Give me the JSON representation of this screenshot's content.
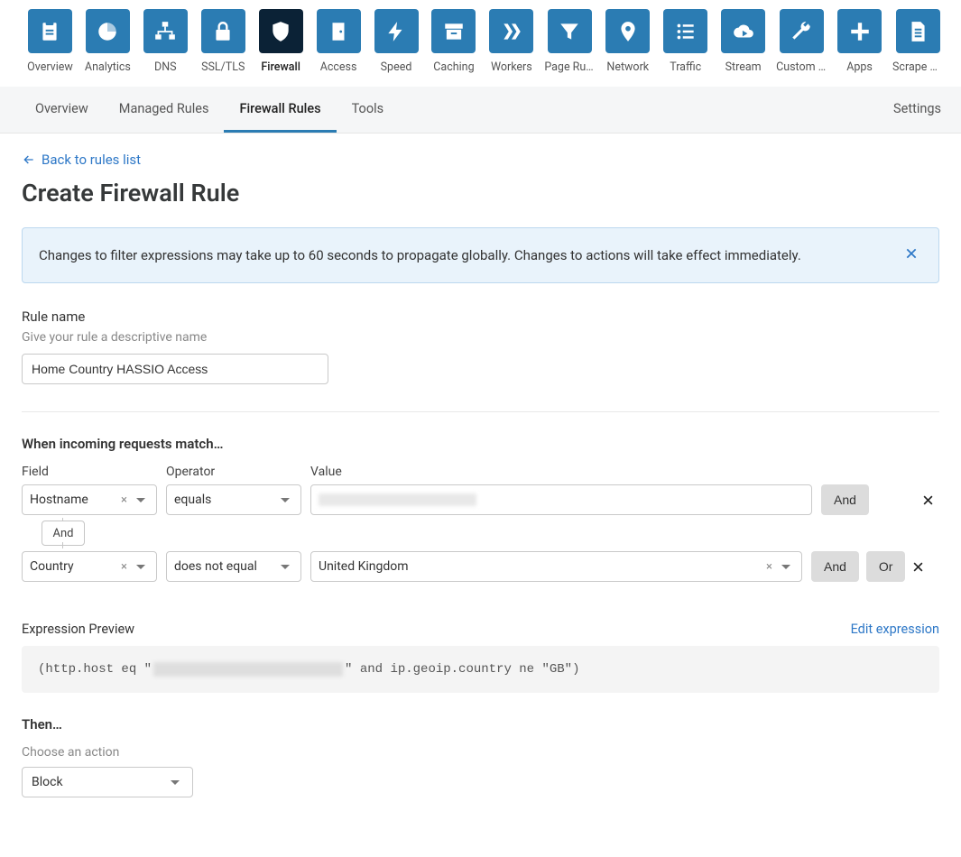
{
  "nav": {
    "items": [
      {
        "label": "Overview"
      },
      {
        "label": "Analytics"
      },
      {
        "label": "DNS"
      },
      {
        "label": "SSL/TLS"
      },
      {
        "label": "Firewall"
      },
      {
        "label": "Access"
      },
      {
        "label": "Speed"
      },
      {
        "label": "Caching"
      },
      {
        "label": "Workers"
      },
      {
        "label": "Page Rules"
      },
      {
        "label": "Network"
      },
      {
        "label": "Traffic"
      },
      {
        "label": "Stream"
      },
      {
        "label": "Custom P…"
      },
      {
        "label": "Apps"
      },
      {
        "label": "Scrape Shi…"
      }
    ]
  },
  "subnav": {
    "items": [
      {
        "label": "Overview"
      },
      {
        "label": "Managed Rules"
      },
      {
        "label": "Firewall Rules"
      },
      {
        "label": "Tools"
      }
    ],
    "settings": "Settings"
  },
  "back_link": "Back to rules list",
  "page_title": "Create Firewall Rule",
  "banner": "Changes to filter expressions may take up to 60 seconds to propagate globally. Changes to actions will take effect immediately.",
  "rule_name": {
    "label": "Rule name",
    "hint": "Give your rule a descriptive name",
    "value": "Home Country HASSIO Access"
  },
  "match": {
    "title": "When incoming requests match…",
    "headers": {
      "field": "Field",
      "operator": "Operator",
      "value": "Value"
    },
    "rows": [
      {
        "field": "Hostname",
        "operator": "equals",
        "value": ""
      },
      {
        "field": "Country",
        "operator": "does not equal",
        "value": "United Kingdom"
      }
    ],
    "connector": "And",
    "and": "And",
    "or": "Or"
  },
  "expression": {
    "title": "Expression Preview",
    "edit": "Edit expression",
    "pre": "(http.host eq \"",
    "post": "\" and ip.geoip.country ne \"GB\")"
  },
  "then": {
    "title": "Then…",
    "hint": "Choose an action",
    "value": "Block"
  }
}
